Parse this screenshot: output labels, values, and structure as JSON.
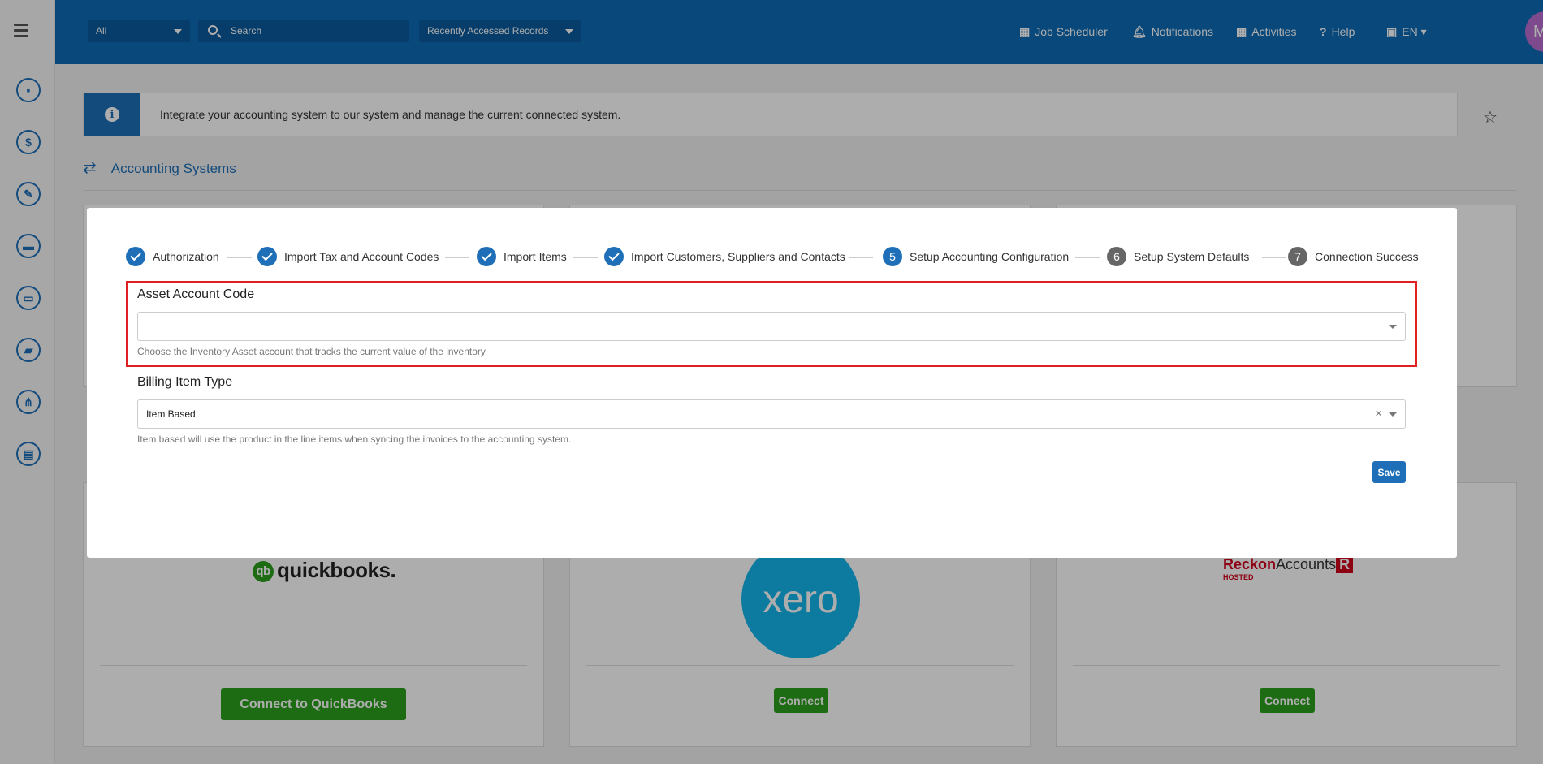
{
  "topbar": {
    "scope_select": "All",
    "search_placeholder": "Search",
    "recent_select": "Recently Accessed Records",
    "job_scheduler": "Job Scheduler",
    "notifications": "Notifications",
    "activities": "Activities",
    "help": "Help",
    "language": "EN",
    "avatar_initials": "MS"
  },
  "sidebar": {
    "items": [
      "contacts-icon",
      "dollar-icon",
      "wrench-icon",
      "briefcase-icon",
      "store-icon",
      "wallet-icon",
      "workflow-icon",
      "report-icon"
    ]
  },
  "banner": {
    "text": "Integrate your accounting system to our system and manage the current connected system."
  },
  "section": {
    "title": "Accounting Systems"
  },
  "cards": {
    "quickbooks": {
      "logo_text": "quickbooks.",
      "button": "Connect to QuickBooks"
    },
    "xero": {
      "logo_text": "xero",
      "button": "Connect"
    },
    "reckon": {
      "logo_text_a": "Reckon",
      "logo_text_b": "Accounts",
      "logo_sub": "HOSTED",
      "button": "Connect"
    }
  },
  "modal": {
    "steps": [
      {
        "label": "Authorization",
        "state": "done"
      },
      {
        "label": "Import Tax and Account Codes",
        "state": "done"
      },
      {
        "label": "Import Items",
        "state": "done"
      },
      {
        "label": "Import Customers, Suppliers and Contacts",
        "state": "done"
      },
      {
        "number": "5",
        "label": "Setup Accounting Configuration",
        "state": "current"
      },
      {
        "number": "6",
        "label": "Setup System Defaults",
        "state": "pending"
      },
      {
        "number": "7",
        "label": "Connection Success",
        "state": "pending"
      }
    ],
    "asset_account": {
      "label": "Asset Account Code",
      "value": "",
      "help": "Choose the Inventory Asset account that tracks the current value of the inventory"
    },
    "billing_item_type": {
      "label": "Billing Item Type",
      "value": "Item Based",
      "help": "Item based will use the product in the line items when syncing the invoices to the accounting system."
    },
    "save_label": "Save"
  },
  "colors": {
    "primary": "#1e6fb8",
    "topbar": "#0d6ab5",
    "highlight": "#e02020",
    "connect_green": "#2ca01c"
  }
}
